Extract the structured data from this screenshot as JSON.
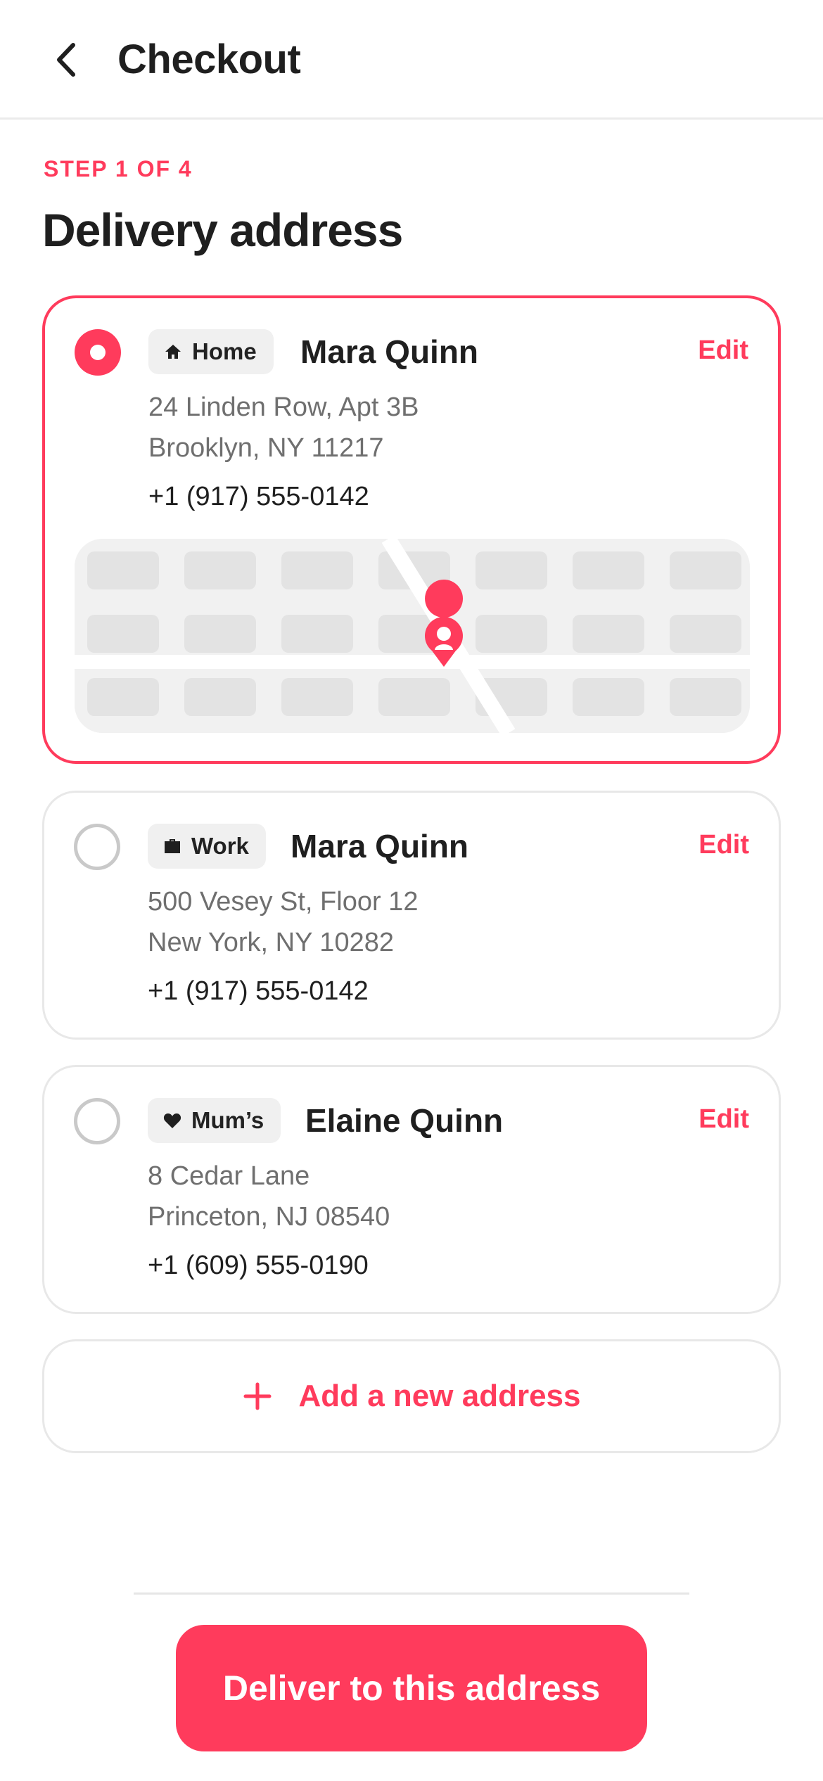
{
  "header": {
    "title": "Checkout",
    "back_icon": "chevron-left-icon"
  },
  "step_label": "STEP 1 OF 4",
  "section_title": "Delivery address",
  "accent_color": "#ff3b5c",
  "addresses": [
    {
      "tag": "Home",
      "tag_icon": "home-icon",
      "name": "Mara Quinn",
      "line1": "24 Linden Row, Apt 3B",
      "line2": "Brooklyn, NY 11217",
      "phone": "+1 (917) 555-0142",
      "edit_label": "Edit",
      "selected": true,
      "map_pin_icon": "location-pin-icon"
    },
    {
      "tag": "Work",
      "tag_icon": "briefcase-icon",
      "name": "Mara Quinn",
      "line1": "500 Vesey St, Floor 12",
      "line2": "New York, NY 10282",
      "phone": "+1 (917) 555-0142",
      "edit_label": "Edit",
      "selected": false
    },
    {
      "tag": "Mum’s",
      "tag_icon": "heart-icon",
      "name": "Elaine Quinn",
      "line1": "8 Cedar Lane",
      "line2": "Princeton, NJ 08540",
      "phone": "+1 (609) 555-0190",
      "edit_label": "Edit",
      "selected": false
    }
  ],
  "add_address": {
    "label": "Add a new address",
    "icon": "plus-icon"
  },
  "cta": {
    "label": "Deliver to this address"
  }
}
